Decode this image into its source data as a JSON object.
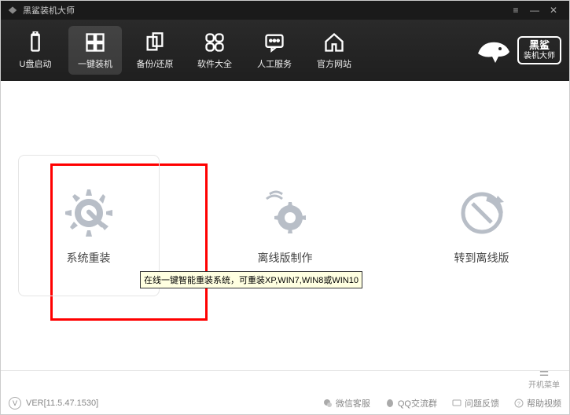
{
  "titlebar": {
    "title": "黑鲨装机大师"
  },
  "toolbar": {
    "items": [
      {
        "label": "U盘启动"
      },
      {
        "label": "一键装机"
      },
      {
        "label": "备份/还原"
      },
      {
        "label": "软件大全"
      },
      {
        "label": "人工服务"
      },
      {
        "label": "官方网站"
      }
    ]
  },
  "brand": {
    "line1": "黑鲨",
    "line2": "装机大师"
  },
  "content": {
    "cards": [
      {
        "label": "系统重装"
      },
      {
        "label": "离线版制作"
      },
      {
        "label": "转到离线版"
      }
    ],
    "tooltip": "在线一键智能重装系统，可重装XP,WIN7,WIN8或WIN10"
  },
  "footer": {
    "boot_menu": "开机菜单",
    "version": "VER[11.5.47.1530]",
    "links": [
      {
        "label": "微信客服"
      },
      {
        "label": "QQ交流群"
      },
      {
        "label": "问题反馈"
      },
      {
        "label": "帮助视频"
      }
    ]
  }
}
